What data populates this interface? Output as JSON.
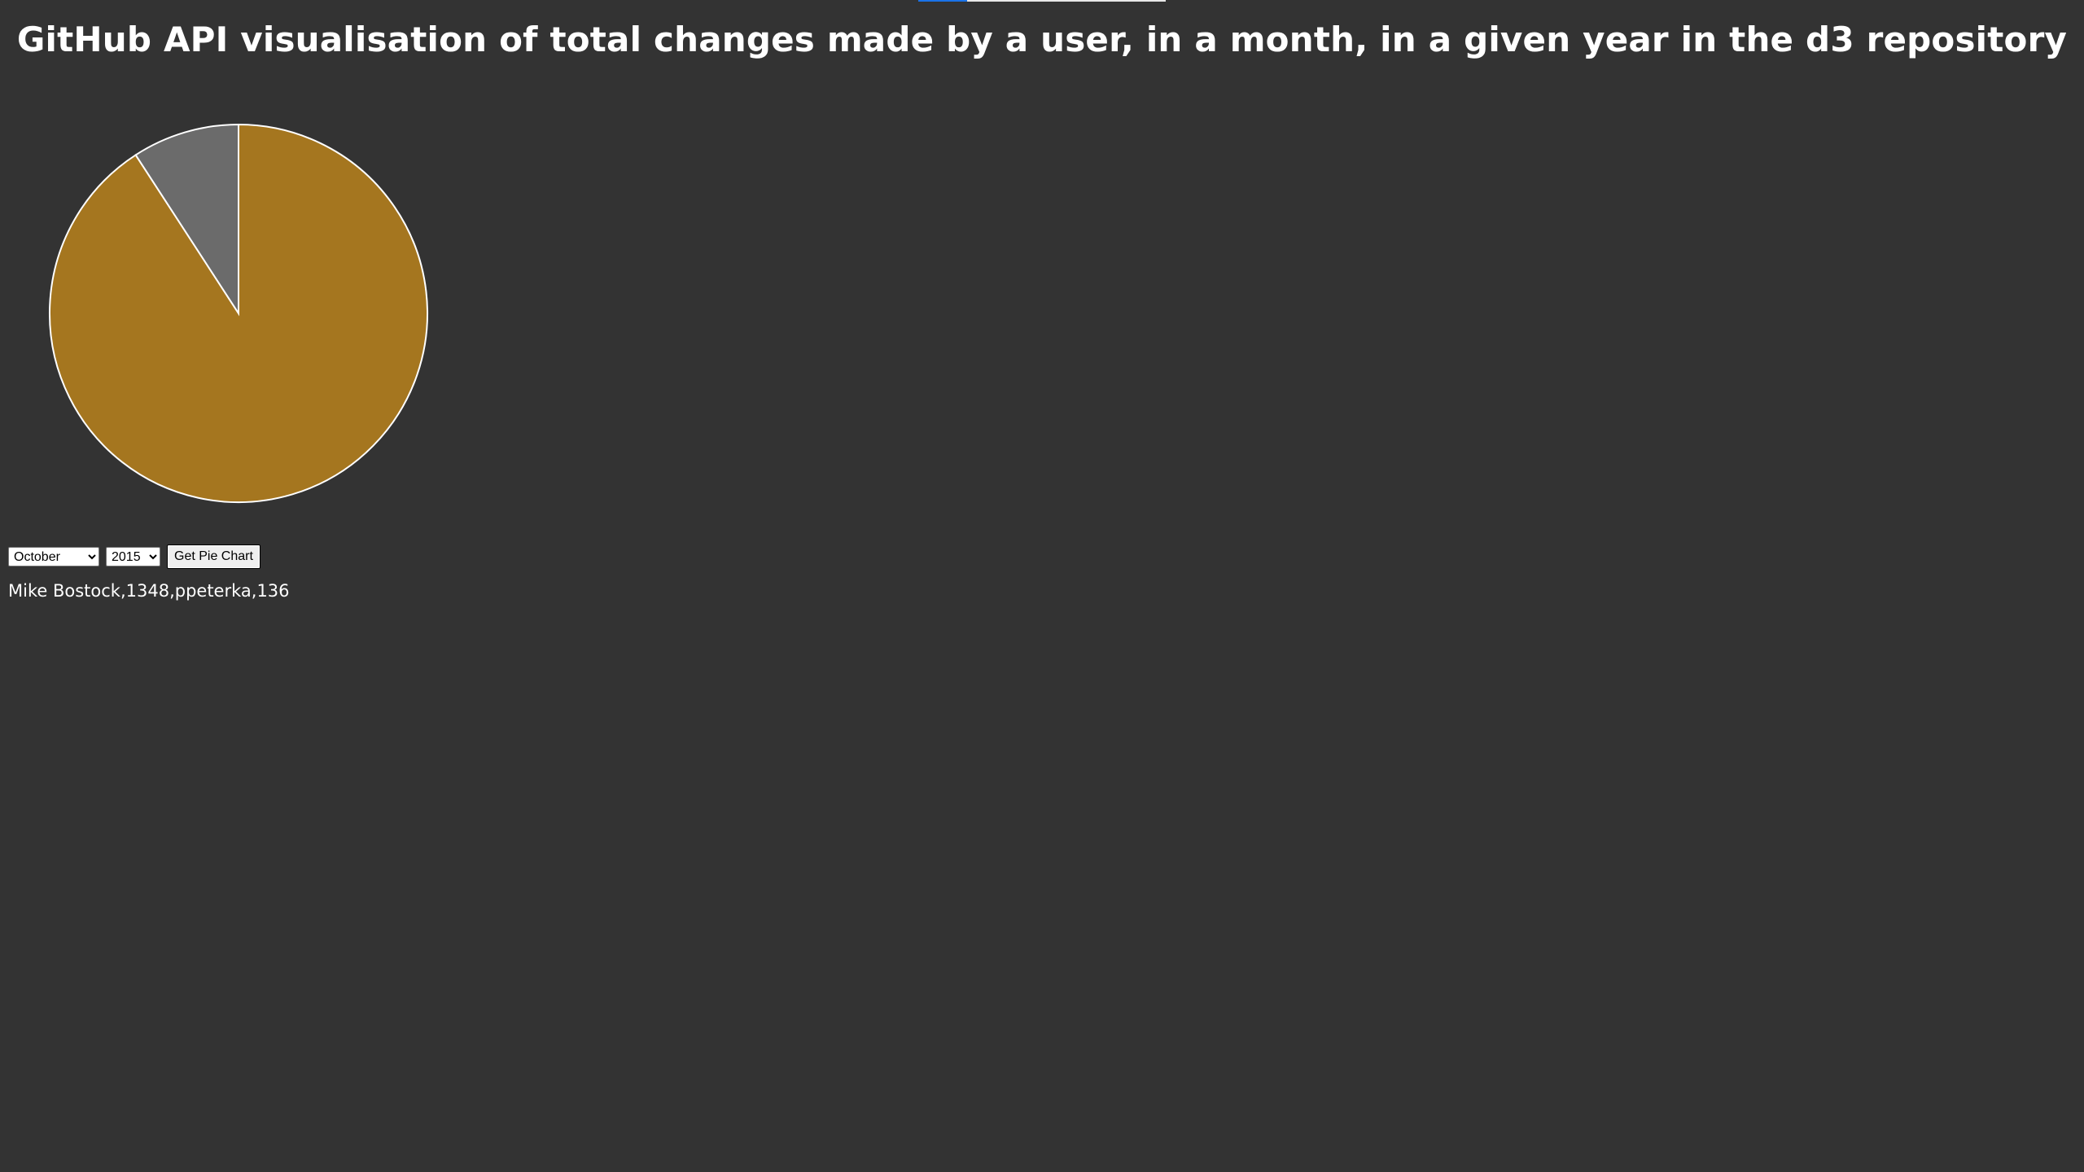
{
  "page": {
    "title": "GitHub API visualisation of total changes made by a user, in a month, in a given year in the d3 repository"
  },
  "controls": {
    "month_selected": "October",
    "year_selected": "2015",
    "button_label": "Get Pie Chart"
  },
  "result": {
    "text": "Mike Bostock,1348,ppeterka,136"
  },
  "chart_data": {
    "type": "pie",
    "title": "",
    "slices": [
      {
        "label": "Mike Bostock",
        "value": 1348,
        "color": "#a5761f"
      },
      {
        "label": "ppeterka",
        "value": 136,
        "color": "#6b6b6b"
      }
    ],
    "start_angle": "top, clockwise",
    "slice_stroke": "#ffffff"
  }
}
